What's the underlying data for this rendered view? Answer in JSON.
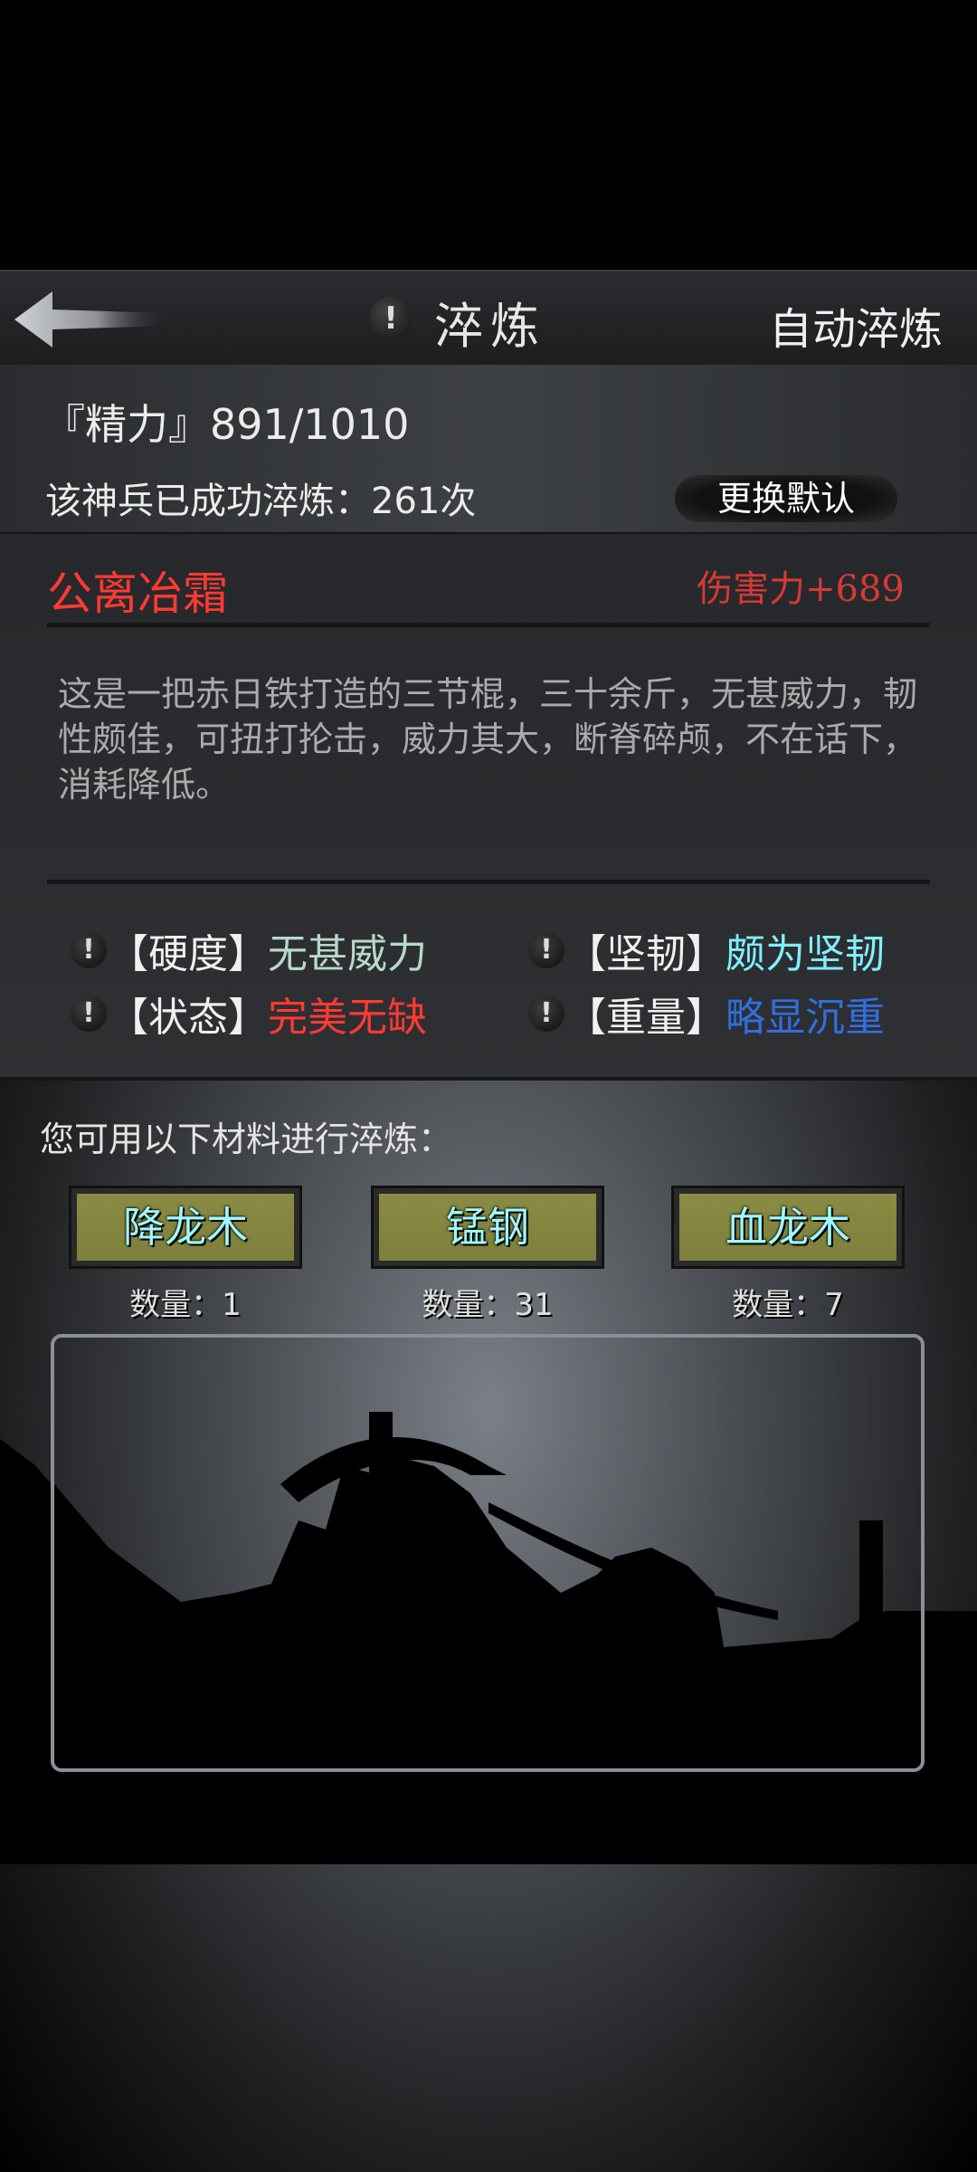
{
  "header": {
    "title": "淬炼",
    "info_icon": "!",
    "auto_refine_label": "自动淬炼"
  },
  "stats": {
    "energy": "『精力』891/1010",
    "refine_count": "该神兵已成功淬炼：261次",
    "change_default_label": "更换默认"
  },
  "weapon": {
    "name": "公离冶霜",
    "damage": "伤害力+689",
    "description": "这是一把赤日铁打造的三节棍，三十余斤，无甚威力，韧性颇佳，可扭打抡击，威力其大，断脊碎颅，不在话下，消耗降低。",
    "attributes": [
      {
        "key": "【硬度】",
        "value": "无甚威力",
        "color": "#b6d9c9"
      },
      {
        "key": "【坚韧】",
        "value": "颇为坚韧",
        "color": "#7ff0ff"
      },
      {
        "key": "【状态】",
        "value": "完美无缺",
        "color": "#ff3a33"
      },
      {
        "key": "【重量】",
        "value": "略显沉重",
        "color": "#2f6fe0"
      }
    ]
  },
  "materials": {
    "label": "您可用以下材料进行淬炼：",
    "items": [
      {
        "name": "降龙木",
        "qty": "数量：1"
      },
      {
        "name": "锰钢",
        "qty": "数量：31"
      },
      {
        "name": "血龙木",
        "qty": "数量：7"
      }
    ]
  },
  "icons": {
    "back": "arrow-left-icon",
    "info": "exclamation-icon"
  }
}
